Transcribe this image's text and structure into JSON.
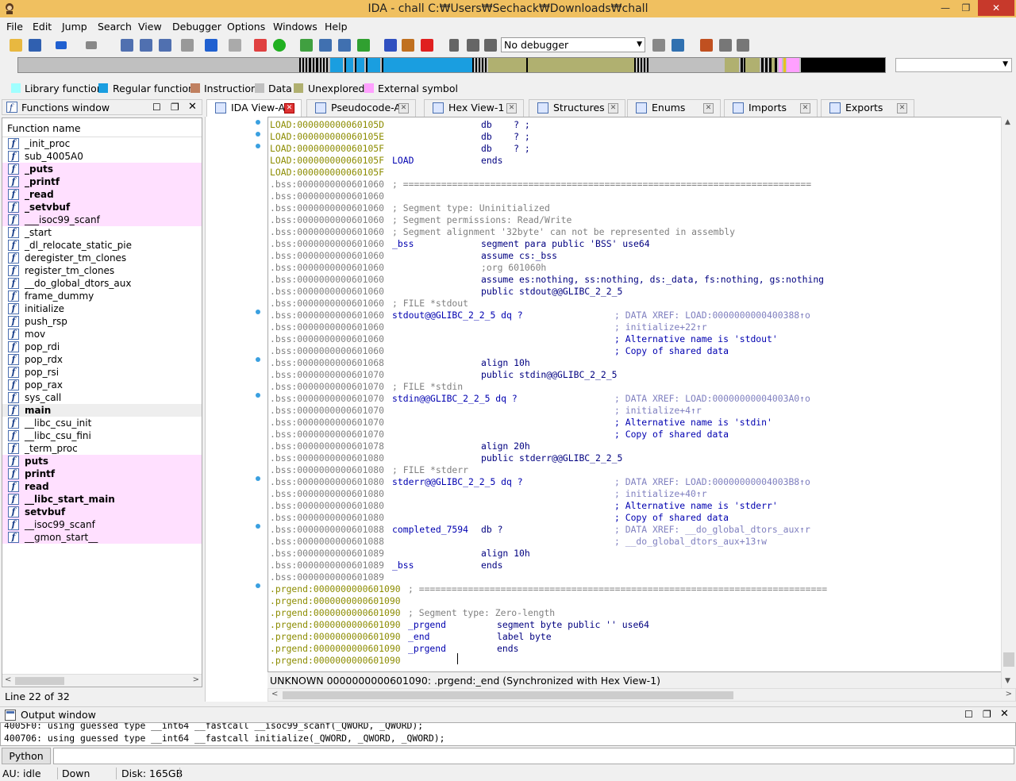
{
  "window": {
    "title": "IDA - chall C:₩Users₩Sechack₩Downloads₩chall",
    "min": "—",
    "max": "❐",
    "close": "✕"
  },
  "menu": [
    "File",
    "Edit",
    "Jump",
    "Search",
    "View",
    "Debugger",
    "Options",
    "Windows",
    "Help"
  ],
  "toolbar": {
    "debugger_select": "No debugger"
  },
  "legend": [
    {
      "label": "Library function",
      "color": "#a0ffff"
    },
    {
      "label": "Regular function",
      "color": "#1a9ee0"
    },
    {
      "label": "Instruction",
      "color": "#c08060"
    },
    {
      "label": "Data",
      "color": "#c0c0c0"
    },
    {
      "label": "Unexplored",
      "color": "#b0b070"
    },
    {
      "label": "External symbol",
      "color": "#ffa0ff"
    }
  ],
  "functions_window": {
    "title": "Functions window",
    "header": "Function name",
    "status": "Line 22 of 32",
    "items": [
      {
        "name": "_init_proc",
        "lib": false,
        "bold": false
      },
      {
        "name": "sub_4005A0",
        "lib": false,
        "bold": false
      },
      {
        "name": "_puts",
        "lib": true,
        "bold": true
      },
      {
        "name": "_printf",
        "lib": true,
        "bold": true
      },
      {
        "name": "_read",
        "lib": true,
        "bold": true
      },
      {
        "name": "_setvbuf",
        "lib": true,
        "bold": true
      },
      {
        "name": "___isoc99_scanf",
        "lib": true,
        "bold": false
      },
      {
        "name": "_start",
        "lib": false,
        "bold": false
      },
      {
        "name": "_dl_relocate_static_pie",
        "lib": false,
        "bold": false
      },
      {
        "name": "deregister_tm_clones",
        "lib": false,
        "bold": false
      },
      {
        "name": "register_tm_clones",
        "lib": false,
        "bold": false
      },
      {
        "name": "__do_global_dtors_aux",
        "lib": false,
        "bold": false
      },
      {
        "name": "frame_dummy",
        "lib": false,
        "bold": false
      },
      {
        "name": "initialize",
        "lib": false,
        "bold": false
      },
      {
        "name": "push_rsp",
        "lib": false,
        "bold": false
      },
      {
        "name": "mov",
        "lib": false,
        "bold": false
      },
      {
        "name": "pop_rdi",
        "lib": false,
        "bold": false
      },
      {
        "name": "pop_rdx",
        "lib": false,
        "bold": false
      },
      {
        "name": "pop_rsi",
        "lib": false,
        "bold": false
      },
      {
        "name": "pop_rax",
        "lib": false,
        "bold": false
      },
      {
        "name": "sys_call",
        "lib": false,
        "bold": false
      },
      {
        "name": "main",
        "lib": false,
        "bold": true,
        "selected": true
      },
      {
        "name": "__libc_csu_init",
        "lib": false,
        "bold": false
      },
      {
        "name": "__libc_csu_fini",
        "lib": false,
        "bold": false
      },
      {
        "name": "_term_proc",
        "lib": false,
        "bold": false
      },
      {
        "name": "puts",
        "lib": true,
        "bold": true
      },
      {
        "name": "printf",
        "lib": true,
        "bold": true
      },
      {
        "name": "read",
        "lib": true,
        "bold": true
      },
      {
        "name": "__libc_start_main",
        "lib": true,
        "bold": true
      },
      {
        "name": "setvbuf",
        "lib": true,
        "bold": true
      },
      {
        "name": "__isoc99_scanf",
        "lib": true,
        "bold": false
      },
      {
        "name": "__gmon_start__",
        "lib": true,
        "bold": false
      }
    ]
  },
  "tabs": [
    {
      "label": "IDA View-A",
      "active": true
    },
    {
      "label": "Pseudocode-A",
      "active": false
    },
    {
      "label": "Hex View-1",
      "active": false
    },
    {
      "label": "Structures",
      "active": false
    },
    {
      "label": "Enums",
      "active": false
    },
    {
      "label": "Imports",
      "active": false
    },
    {
      "label": "Exports",
      "active": false
    }
  ],
  "listing": [
    {
      "addr": "LOAD:000000000060105D",
      "seg": "load",
      "c1": "",
      "c2": "db    ? ;",
      "c3": ""
    },
    {
      "addr": "LOAD:000000000060105E",
      "seg": "load",
      "c1": "",
      "c2": "db    ? ;",
      "c3": ""
    },
    {
      "addr": "LOAD:000000000060105F",
      "seg": "load",
      "c1": "",
      "c2": "db    ? ;",
      "c3": ""
    },
    {
      "addr": "LOAD:000000000060105F",
      "seg": "load",
      "c1": "LOAD",
      "c2": "ends",
      "c3": ""
    },
    {
      "addr": "LOAD:000000000060105F",
      "seg": "load",
      "c1": "",
      "c2": "",
      "c3": ""
    },
    {
      "addr": ".bss:0000000000601060",
      "seg": "bss",
      "c1": "; ===========================================================================",
      "c1cls": "comment",
      "c2": "",
      "c3": ""
    },
    {
      "addr": ".bss:0000000000601060",
      "seg": "bss",
      "c1": "",
      "c2": "",
      "c3": ""
    },
    {
      "addr": ".bss:0000000000601060",
      "seg": "bss",
      "c1": "; Segment type: Uninitialized",
      "c1cls": "comment",
      "c2": "",
      "c3": ""
    },
    {
      "addr": ".bss:0000000000601060",
      "seg": "bss",
      "c1": "; Segment permissions: Read/Write",
      "c1cls": "comment",
      "c2": "",
      "c3": ""
    },
    {
      "addr": ".bss:0000000000601060",
      "seg": "bss",
      "c1": "; Segment alignment '32byte' can not be represented in assembly",
      "c1cls": "comment",
      "c2": "",
      "c3": ""
    },
    {
      "addr": ".bss:0000000000601060",
      "seg": "bss",
      "c1": "_bss",
      "c2": "segment para public 'BSS' use64",
      "c3": ""
    },
    {
      "addr": ".bss:0000000000601060",
      "seg": "bss",
      "c1": "",
      "c2": "assume cs:_bss",
      "c3": ""
    },
    {
      "addr": ".bss:0000000000601060",
      "seg": "bss",
      "c1": "",
      "c2": ";org 601060h",
      "c2cls": "comment",
      "c3": ""
    },
    {
      "addr": ".bss:0000000000601060",
      "seg": "bss",
      "c1": "",
      "c2": "assume es:nothing, ss:nothing, ds:_data, fs:nothing, gs:nothing",
      "c3": ""
    },
    {
      "addr": ".bss:0000000000601060",
      "seg": "bss",
      "c1": "",
      "c2": "public stdout@@GLIBC_2_2_5",
      "c3": ""
    },
    {
      "addr": ".bss:0000000000601060",
      "seg": "bss",
      "c1": "; FILE *stdout",
      "c1cls": "comment",
      "c2": "",
      "c3": ""
    },
    {
      "addr": ".bss:0000000000601060",
      "seg": "bss",
      "c1": "stdout@@GLIBC_2_2_5 dq ?",
      "c2": "",
      "c3": "; DATA XREF: LOAD:0000000000400388↑o",
      "c3cls": "xref"
    },
    {
      "addr": ".bss:0000000000601060",
      "seg": "bss",
      "c1": "",
      "c2": "",
      "c3": "; initialize+22↑r",
      "c3cls": "xref"
    },
    {
      "addr": ".bss:0000000000601060",
      "seg": "bss",
      "c1": "",
      "c2": "",
      "c3": "; Alternative name is 'stdout'",
      "c3cls": "blue"
    },
    {
      "addr": ".bss:0000000000601060",
      "seg": "bss",
      "c1": "",
      "c2": "",
      "c3": "; Copy of shared data",
      "c3cls": "blue"
    },
    {
      "addr": ".bss:0000000000601068",
      "seg": "bss",
      "c1": "",
      "c2": "align 10h",
      "c3": ""
    },
    {
      "addr": ".bss:0000000000601070",
      "seg": "bss",
      "c1": "",
      "c2": "public stdin@@GLIBC_2_2_5",
      "c3": ""
    },
    {
      "addr": ".bss:0000000000601070",
      "seg": "bss",
      "c1": "; FILE *stdin",
      "c1cls": "comment",
      "c2": "",
      "c3": ""
    },
    {
      "addr": ".bss:0000000000601070",
      "seg": "bss",
      "c1": "stdin@@GLIBC_2_2_5 dq ?",
      "c2": "",
      "c3": "; DATA XREF: LOAD:00000000004003A0↑o",
      "c3cls": "xref"
    },
    {
      "addr": ".bss:0000000000601070",
      "seg": "bss",
      "c1": "",
      "c2": "",
      "c3": "; initialize+4↑r",
      "c3cls": "xref"
    },
    {
      "addr": ".bss:0000000000601070",
      "seg": "bss",
      "c1": "",
      "c2": "",
      "c3": "; Alternative name is 'stdin'",
      "c3cls": "blue"
    },
    {
      "addr": ".bss:0000000000601070",
      "seg": "bss",
      "c1": "",
      "c2": "",
      "c3": "; Copy of shared data",
      "c3cls": "blue"
    },
    {
      "addr": ".bss:0000000000601078",
      "seg": "bss",
      "c1": "",
      "c2": "align 20h",
      "c3": ""
    },
    {
      "addr": ".bss:0000000000601080",
      "seg": "bss",
      "c1": "",
      "c2": "public stderr@@GLIBC_2_2_5",
      "c3": ""
    },
    {
      "addr": ".bss:0000000000601080",
      "seg": "bss",
      "c1": "; FILE *stderr",
      "c1cls": "comment",
      "c2": "",
      "c3": ""
    },
    {
      "addr": ".bss:0000000000601080",
      "seg": "bss",
      "c1": "stderr@@GLIBC_2_2_5 dq ?",
      "c2": "",
      "c3": "; DATA XREF: LOAD:00000000004003B8↑o",
      "c3cls": "xref"
    },
    {
      "addr": ".bss:0000000000601080",
      "seg": "bss",
      "c1": "",
      "c2": "",
      "c3": "; initialize+40↑r",
      "c3cls": "xref"
    },
    {
      "addr": ".bss:0000000000601080",
      "seg": "bss",
      "c1": "",
      "c2": "",
      "c3": "; Alternative name is 'stderr'",
      "c3cls": "blue"
    },
    {
      "addr": ".bss:0000000000601080",
      "seg": "bss",
      "c1": "",
      "c2": "",
      "c3": "; Copy of shared data",
      "c3cls": "blue"
    },
    {
      "addr": ".bss:0000000000601088",
      "seg": "bss",
      "c1": "completed_7594",
      "c2": "db ?",
      "c3": "; DATA XREF: __do_global_dtors_aux↑r",
      "c3cls": "xref"
    },
    {
      "addr": ".bss:0000000000601088",
      "seg": "bss",
      "c1": "",
      "c2": "",
      "c3": "; __do_global_dtors_aux+13↑w",
      "c3cls": "xref"
    },
    {
      "addr": ".bss:0000000000601089",
      "seg": "bss",
      "c1": "",
      "c2": "align 10h",
      "c3": ""
    },
    {
      "addr": ".bss:0000000000601089",
      "seg": "bss",
      "c1": "_bss",
      "c2": "ends",
      "c3": ""
    },
    {
      "addr": ".bss:0000000000601089",
      "seg": "bss",
      "c1": "",
      "c2": "",
      "c3": ""
    },
    {
      "addr": ".prgend:0000000000601090",
      "seg": "prg",
      "c1": "; ===========================================================================",
      "c1cls": "comment",
      "c2": "",
      "c3": ""
    },
    {
      "addr": ".prgend:0000000000601090",
      "seg": "prg",
      "c1": "",
      "c2": "",
      "c3": ""
    },
    {
      "addr": ".prgend:0000000000601090",
      "seg": "prg",
      "c1": "; Segment type: Zero-length",
      "c1cls": "comment",
      "c2": "",
      "c3": ""
    },
    {
      "addr": ".prgend:0000000000601090",
      "seg": "prg",
      "c1": "_prgend",
      "c2": "segment byte public '' use64",
      "c3": ""
    },
    {
      "addr": ".prgend:0000000000601090",
      "seg": "prg",
      "c1": "_end",
      "c2": "label byte",
      "c3": ""
    },
    {
      "addr": ".prgend:0000000000601090",
      "seg": "prg",
      "c1": "_prgend",
      "c2": "ends",
      "c3": ""
    },
    {
      "addr": ".prgend:0000000000601090",
      "seg": "prg",
      "c1": "",
      "c2": "",
      "c3": ""
    }
  ],
  "listing_status": "UNKNOWN 0000000000601090: .prgend:_end (Synchronized with Hex View-1)",
  "output_window": {
    "title": "Output window",
    "lines": [
      "4005F0: using guessed type __int64 __fastcall __isoc99_scanf(_QWORD, _QWORD);",
      "400706: using guessed type __int64 __fastcall initialize(_QWORD, _QWORD, _QWORD);"
    ]
  },
  "command": {
    "button": "Python"
  },
  "status": {
    "au": "AU:",
    "au_state": "idle",
    "direction": "Down",
    "disk": "Disk: 165GB"
  }
}
